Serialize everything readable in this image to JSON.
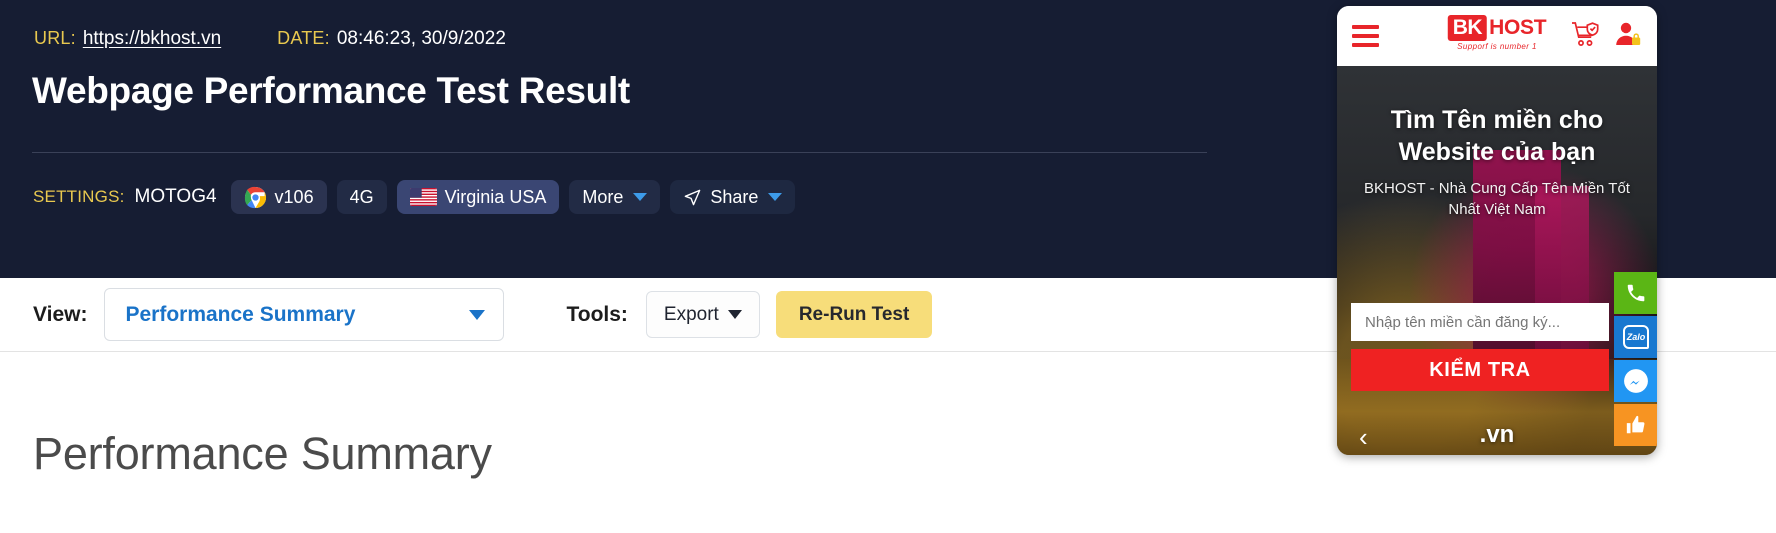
{
  "header": {
    "url_label": "URL:",
    "url_value": "https://bkhost.vn",
    "date_label": "DATE:",
    "date_value": "08:46:23, 30/9/2022",
    "title": "Webpage Performance Test Result",
    "settings_label": "SETTINGS:",
    "device": "MOTOG4",
    "browser": "v106",
    "connection": "4G",
    "location": "Virginia USA",
    "more": "More",
    "share": "Share",
    "accent_yellow": "#e8c84f",
    "background": "#161d33"
  },
  "toolbar": {
    "view_label": "View:",
    "view_value": "Performance Summary",
    "tools_label": "Tools:",
    "export_label": "Export",
    "rerun_label": "Re-Run Test",
    "accent_blue": "#1a73c8",
    "rerun_color": "#f7dd7a"
  },
  "main": {
    "section_title": "Performance Summary"
  },
  "phone": {
    "brand_mark": "BK",
    "brand_word": "HOST",
    "brand_tagline": "Supporf is number 1",
    "hero_title_line1": "Tìm Tên miền cho",
    "hero_title_line2": "Website của bạn",
    "hero_subtitle": "BKHOST - Nhà Cung Cấp Tên Miền Tốt Nhất Việt Nam",
    "search_placeholder": "Nhập tên miền cần đăng ký...",
    "cta_label": "KIỂM TRA",
    "tld_label": ".vn",
    "arrow_prev": "‹",
    "arrow_next": "›",
    "zalo_label": "Zalo",
    "brand_red": "#e8252a",
    "cta_red": "#ef2222"
  }
}
